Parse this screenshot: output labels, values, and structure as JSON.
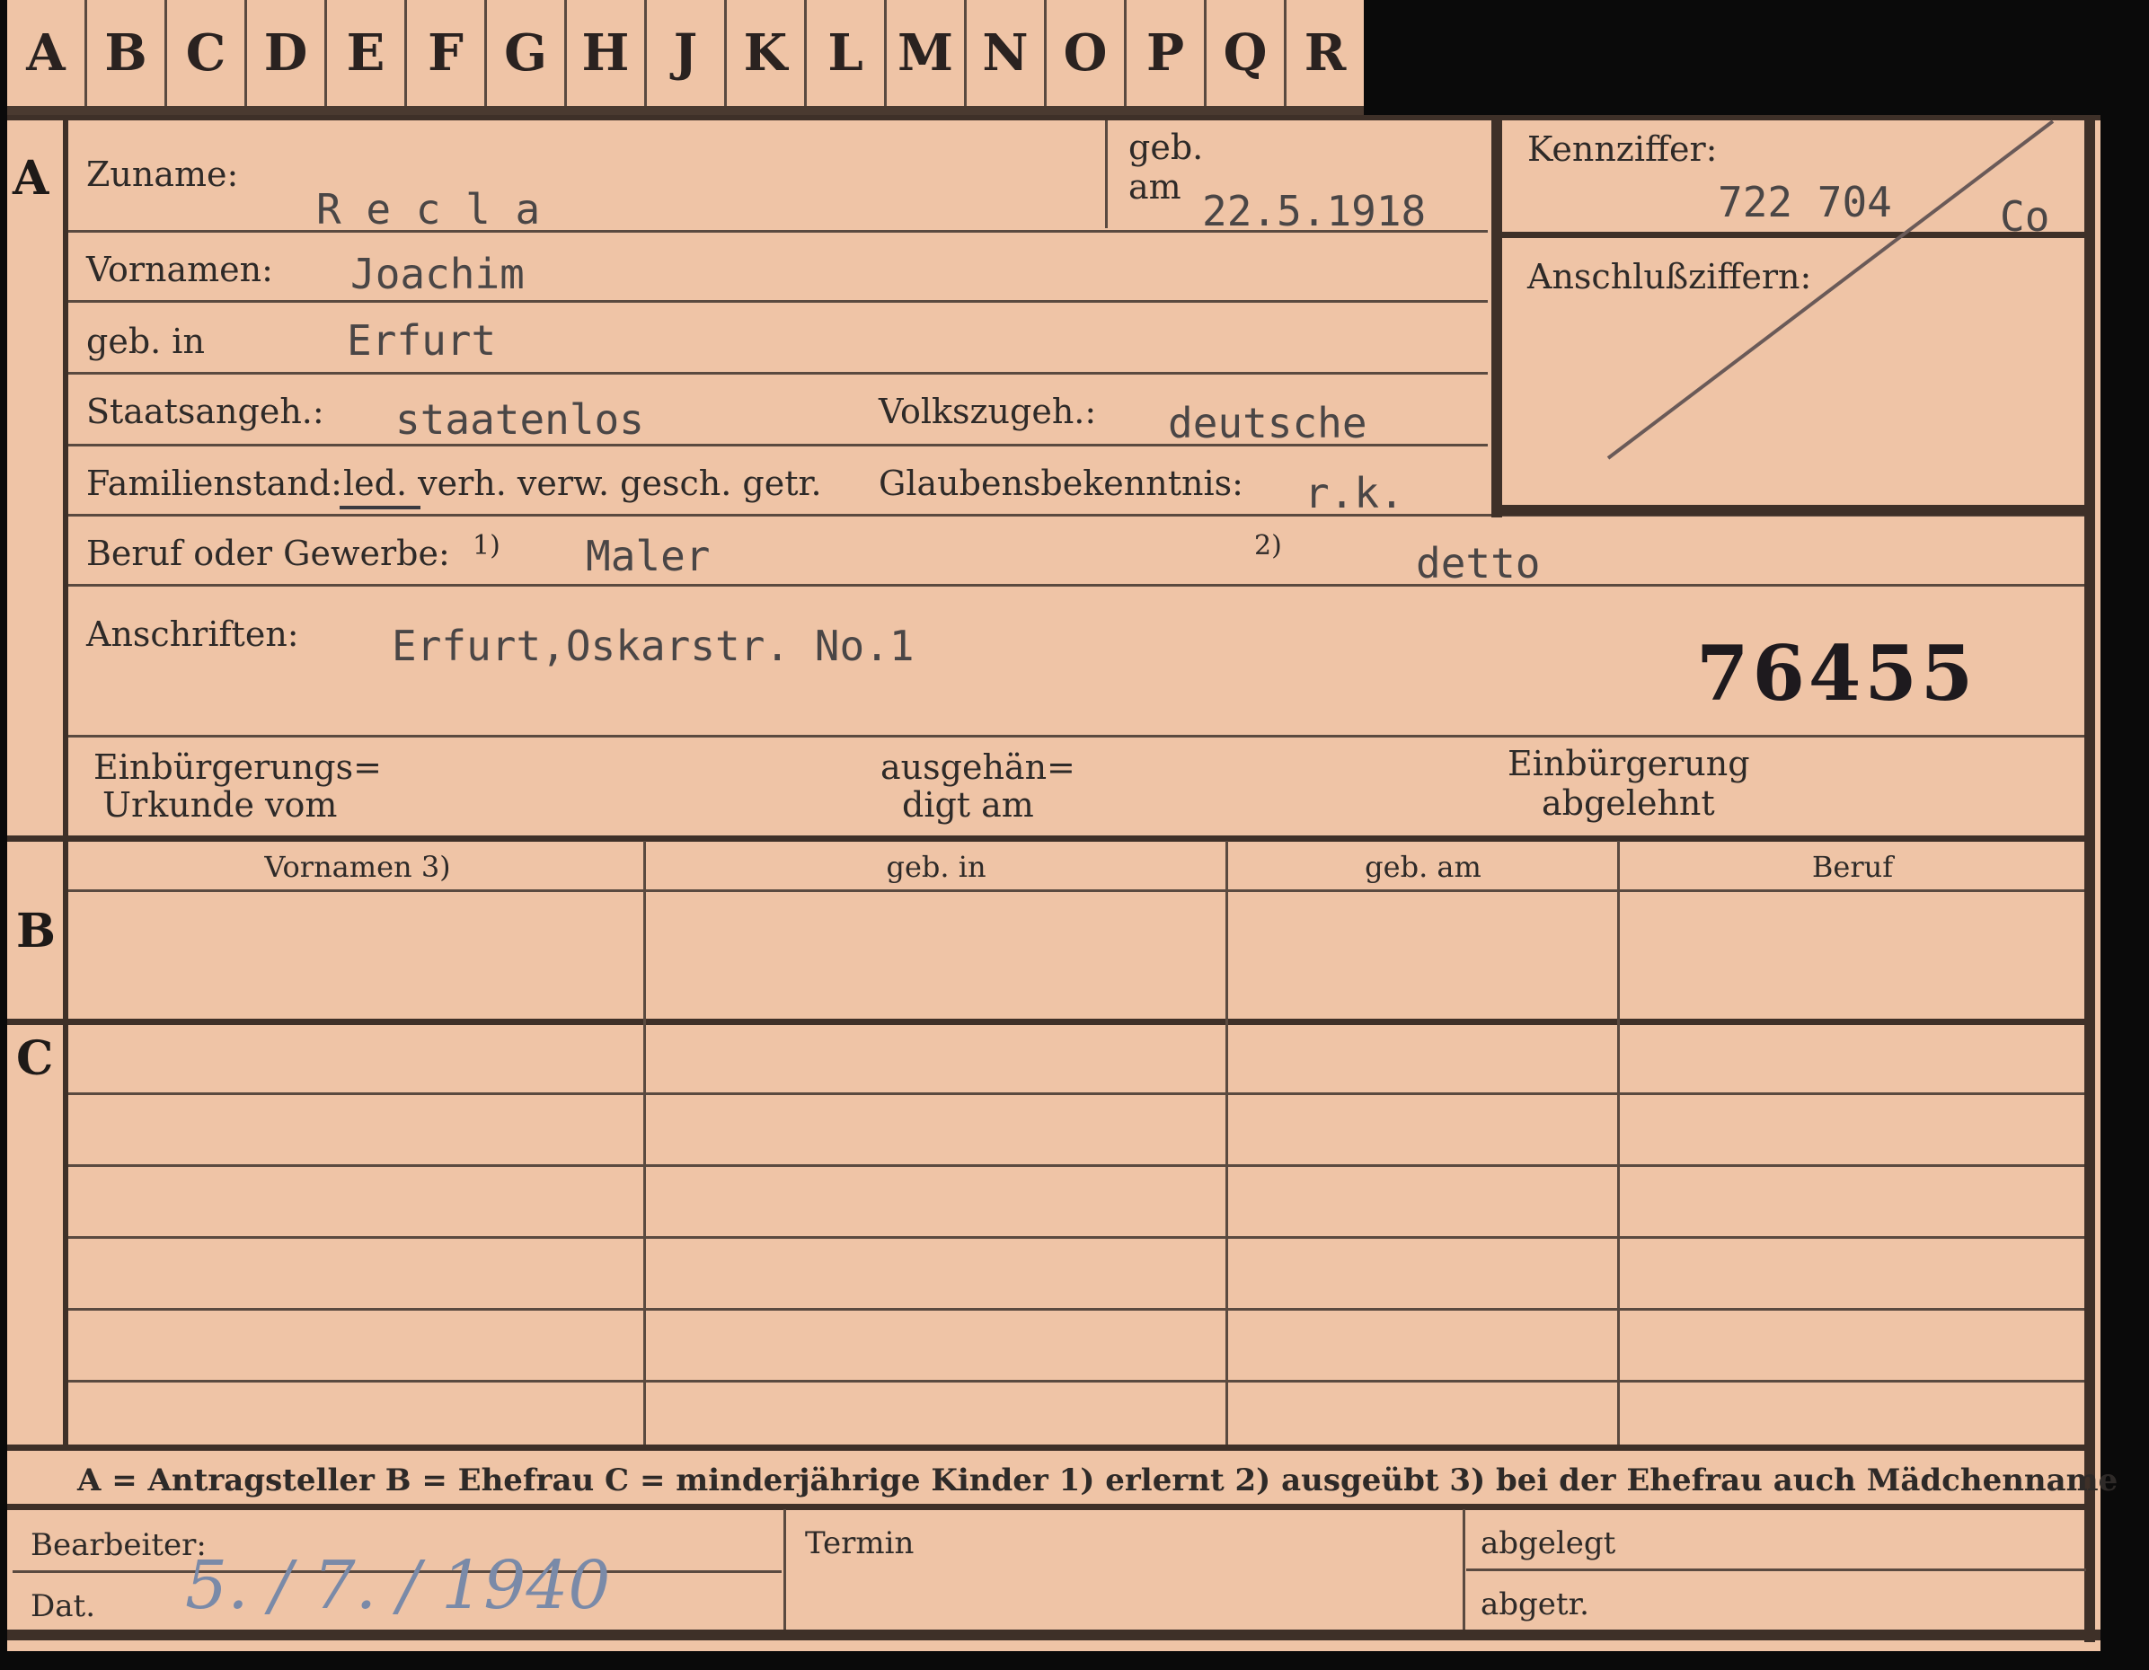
{
  "tabs": [
    "A",
    "B",
    "C",
    "D",
    "E",
    "F",
    "G",
    "H",
    "J",
    "K",
    "L",
    "M",
    "N",
    "O",
    "P",
    "Q",
    "R"
  ],
  "sections": {
    "a": "A",
    "b": "B",
    "c": "C"
  },
  "labels": {
    "zuname": "Zuname:",
    "geb": "geb.",
    "am": "am",
    "vornamen": "Vornamen:",
    "geb_in": "geb. in",
    "staatsangeh": "Staatsangeh.:",
    "volkszugeh": "Volkszugeh.:",
    "familienstand": "Familienstand:",
    "familienstand_options": "led. verh. verw. gesch. getr.",
    "glaubensbekenntnis": "Glaubensbekenntnis:",
    "beruf": "Beruf oder Gewerbe:",
    "fn1": "1)",
    "fn2": "2)",
    "anschriften": "Anschriften:",
    "einbuergerungs_line1": "Einbürgerungs=",
    "einbuergerungs_line2": "Urkunde vom",
    "ausgehaen_line1": "ausgehän=",
    "ausgehaen_line2": "digt am",
    "abgelehnt_line1": "Einbürgerung",
    "abgelehnt_line2": "abgelehnt",
    "kennziffer": "Kennziffer:",
    "anschlussziffern": "Anschlußziffern:"
  },
  "values": {
    "zuname": "R e c l a",
    "geb_am": "22.5.1918",
    "vornamen": "Joachim",
    "geb_in": "Erfurt",
    "staatsangeh": "staatenlos",
    "volkszugeh": "deutsche",
    "glaubensbekenntnis": "r.k.",
    "beruf_erlernt": "Maler",
    "beruf_ausgeuebt": "detto",
    "anschrift": "Erfurt,Oskarstr. No.1",
    "stamp_number": "76455",
    "kennziffer": "722 704",
    "kennziffer_suffix": "Co"
  },
  "table": {
    "headers": [
      "Vornamen 3)",
      "geb. in",
      "geb. am",
      "Beruf"
    ]
  },
  "legend": "A = Antragsteller   B = Ehefrau   C = minderjährige Kinder   1) erlernt   2) ausgeübt   3) bei der Ehefrau auch Mädchenname",
  "footer": {
    "bearbeiter": "Bearbeiter:",
    "dat": "Dat.",
    "date_handwritten": "5. / 7. / 1940",
    "termin": "Termin",
    "abgelegt": "abgelegt",
    "abgetr": "abgetr."
  }
}
